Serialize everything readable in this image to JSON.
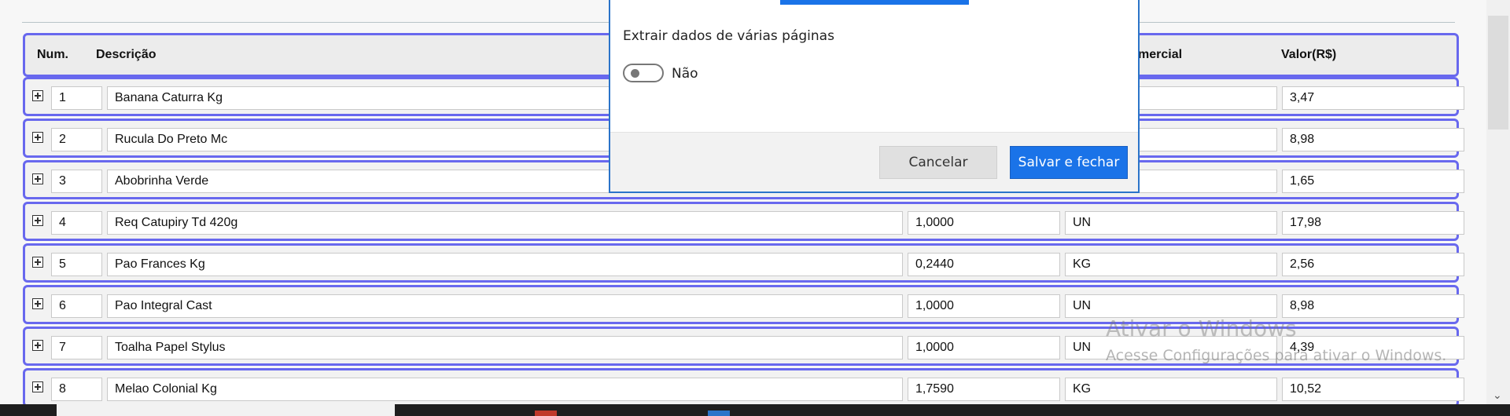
{
  "header": {
    "num": "Num.",
    "descricao": "Descrição",
    "unidade": "mercial",
    "valor": "Valor(R$)"
  },
  "rows": [
    {
      "num": "1",
      "desc": "Banana Caturra Kg",
      "qtd": "",
      "un": "",
      "valor": "3,47"
    },
    {
      "num": "2",
      "desc": "Rucula Do Preto Mc",
      "qtd": "",
      "un": "",
      "valor": "8,98"
    },
    {
      "num": "3",
      "desc": "Abobrinha Verde",
      "qtd": "",
      "un": "",
      "valor": "1,65"
    },
    {
      "num": "4",
      "desc": "Req Catupiry Td 420g",
      "qtd": "1,0000",
      "un": "UN",
      "valor": "17,98"
    },
    {
      "num": "5",
      "desc": "Pao Frances Kg",
      "qtd": "0,2440",
      "un": "KG",
      "valor": "2,56"
    },
    {
      "num": "6",
      "desc": "Pao Integral Cast",
      "qtd": "1,0000",
      "un": "UN",
      "valor": "8,98"
    },
    {
      "num": "7",
      "desc": "Toalha Papel Stylus",
      "qtd": "1,0000",
      "un": "UN",
      "valor": "4,39"
    },
    {
      "num": "8",
      "desc": "Melao Colonial Kg",
      "qtd": "1,7590",
      "un": "KG",
      "valor": "10,52"
    }
  ],
  "modal": {
    "label": "Extrair dados de várias páginas",
    "toggle_text": "Não",
    "toggle_on": false,
    "cancel": "Cancelar",
    "save": "Salvar e fechar"
  },
  "watermark": {
    "line1": "Ativar o Windows",
    "line2": "Acesse Configurações para ativar o Windows."
  },
  "colors": {
    "row_border": "#6868ee",
    "primary": "#1a73e8"
  }
}
